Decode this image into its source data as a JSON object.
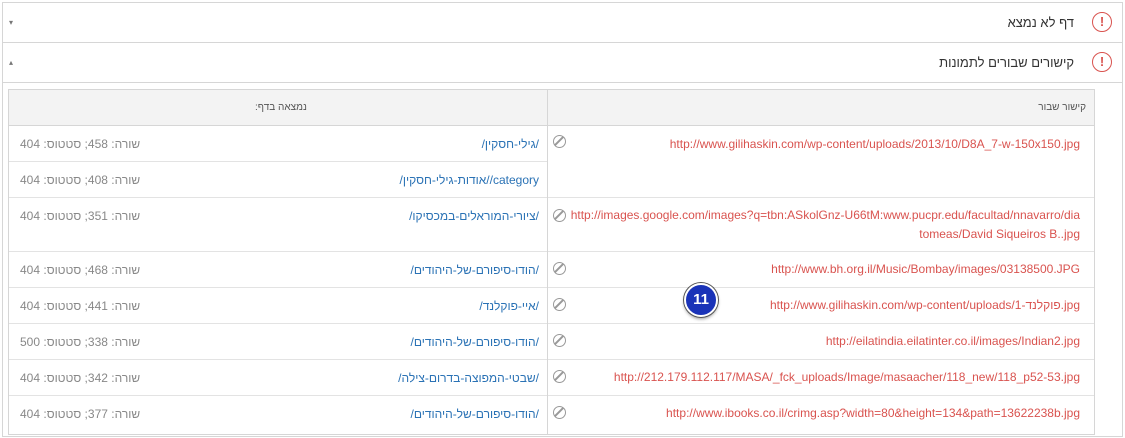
{
  "sections": [
    {
      "title": "דף לא נמצא",
      "alert_glyph": "!",
      "caret": "▾"
    },
    {
      "title": "קישורים שבורים לתמונות",
      "alert_glyph": "!",
      "caret": "▴"
    }
  ],
  "table": {
    "headers": {
      "broken_link": "קישור שבור",
      "found_on": "נמצאה בדף:"
    },
    "broken_links": [
      "http://www.gilihaskin.com/wp-content/uploads/2013/10/D8A_7-w-150x150.jpg",
      "http://images.google.com/images?q=tbn:ASkolGnz-U66tM:www.pucpr.edu/facultad/nnavarro/diatomeas/David Siqueiros B..jpg",
      "http://www.bh.org.il/Music/Bombay/images/03138500.JPG",
      "http://www.gilihaskin.com/wp-content/uploads/פוקלנד-1.jpg",
      "http://eilatindia.eilatinter.co.il/images/Indian2.jpg",
      "http://212.179.112.117/MASA/_fck_uploads/Image/masaacher/118_new/118_p52-53.jpg",
      "http://www.ibooks.co.il/crimg.asp?width=80&height=134&path=13622238b.jpg"
    ],
    "found_rows": [
      {
        "page": "/גילי-חסקין/",
        "status": "שורה: 458; סטטוס: 404"
      },
      {
        "page": "category//אודות-גילי-חסקין/",
        "status": "שורה: 408; סטטוס: 404"
      },
      {
        "page": "/ציורי-המוראלים-במכסיקו/",
        "status": "שורה: 351; סטטוס: 404"
      },
      {
        "page": "/הודו-סיפורם-של-היהודים/",
        "status": "שורה: 468; סטטוס: 404"
      },
      {
        "page": "/איי-פוקלנד/",
        "status": "שורה: 441; סטטוס: 404"
      },
      {
        "page": "/הודו-סיפורם-של-היהודים/",
        "status": "שורה: 338; סטטוס: 500"
      },
      {
        "page": "/שבטי-המפוצה-בדרום-צילה/",
        "status": "שורה: 342; סטטוס: 404"
      },
      {
        "page": "/הודו-סיפורם-של-היהודים/",
        "status": "שורה: 377; סטטוס: 404"
      }
    ]
  },
  "badge": {
    "label": "11"
  },
  "icons": {
    "alert": "alert-circle-icon",
    "no_link": "no-link-icon"
  },
  "colors": {
    "alert": "#d9534f",
    "link": "#2a72b5",
    "badge": "#1a33b8"
  }
}
